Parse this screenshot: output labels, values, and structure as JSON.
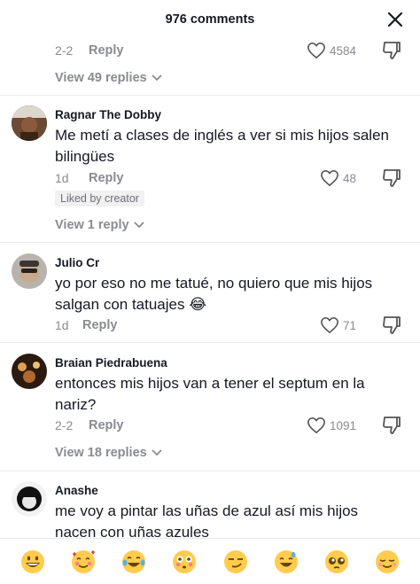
{
  "header": {
    "title": "976 comments"
  },
  "top_comment_footer": {
    "date": "2-2",
    "reply": "Reply",
    "likes": "4584",
    "view_replies": "View 49 replies"
  },
  "comments": [
    {
      "username": "Ragnar The Dobby",
      "text": "Me metí a clases de inglés a ver si mis hijos salen bilingües",
      "date": "1d",
      "reply": "Reply",
      "likes": "48",
      "badge": "Liked by creator",
      "view_replies": "View 1 reply"
    },
    {
      "username": "Julio Cr",
      "text": "yo por eso no me tatué, no quiero que mis hijos salgan con tatuajes 😂",
      "date": "1d",
      "reply": "Reply",
      "likes": "71"
    },
    {
      "username": "Braian Piedrabuena",
      "text": "entonces mis hijos van a tener el septum en la nariz?",
      "date": "2-2",
      "reply": "Reply",
      "likes": "1091",
      "view_replies": "View 18 replies"
    },
    {
      "username": "Anashe",
      "text": "me voy a pintar las uñas de azul así mis hijos nacen con uñas azules"
    }
  ],
  "emoji_bar": [
    "grinning",
    "smiling-hearts",
    "tears-of-joy",
    "flushed",
    "smirking",
    "sweat-smile",
    "pleading",
    "relieved"
  ],
  "colors": {
    "text": "#161823",
    "muted": "#8a8b91",
    "emoji_yellow": "#ffcc4d"
  }
}
